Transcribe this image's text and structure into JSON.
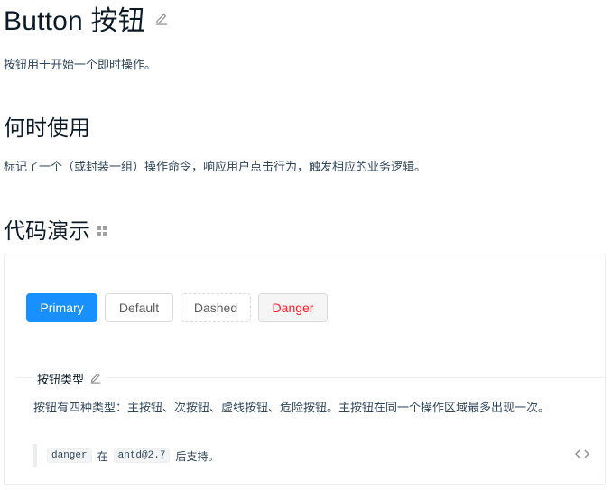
{
  "page": {
    "title": "Button 按钮",
    "intro": "按钮用于开始一个即时操作。"
  },
  "when": {
    "heading": "何时使用",
    "text": "标记了一个（或封装一组）操作命令，响应用户点击行为，触发相应的业务逻辑。"
  },
  "demo": {
    "heading": "代码演示",
    "buttons": {
      "primary": "Primary",
      "default": "Default",
      "dashed": "Dashed",
      "danger": "Danger"
    },
    "meta": {
      "title": "按钮类型",
      "description": "按钮有四种类型：主按钮、次按钮、虚线按钮、危险按钮。主按钮在同一个操作区域最多出现一次。",
      "note_code_1": "danger",
      "note_text_1": "在",
      "note_code_2": "antd@2.7",
      "note_text_2": "后支持。"
    }
  },
  "colors": {
    "primary": "#1890ff",
    "danger": "#f5222d",
    "heading": "#0d1a26",
    "text": "#314659"
  },
  "icons": [
    "edit-icon",
    "grid-icon",
    "code-expand-icon"
  ]
}
